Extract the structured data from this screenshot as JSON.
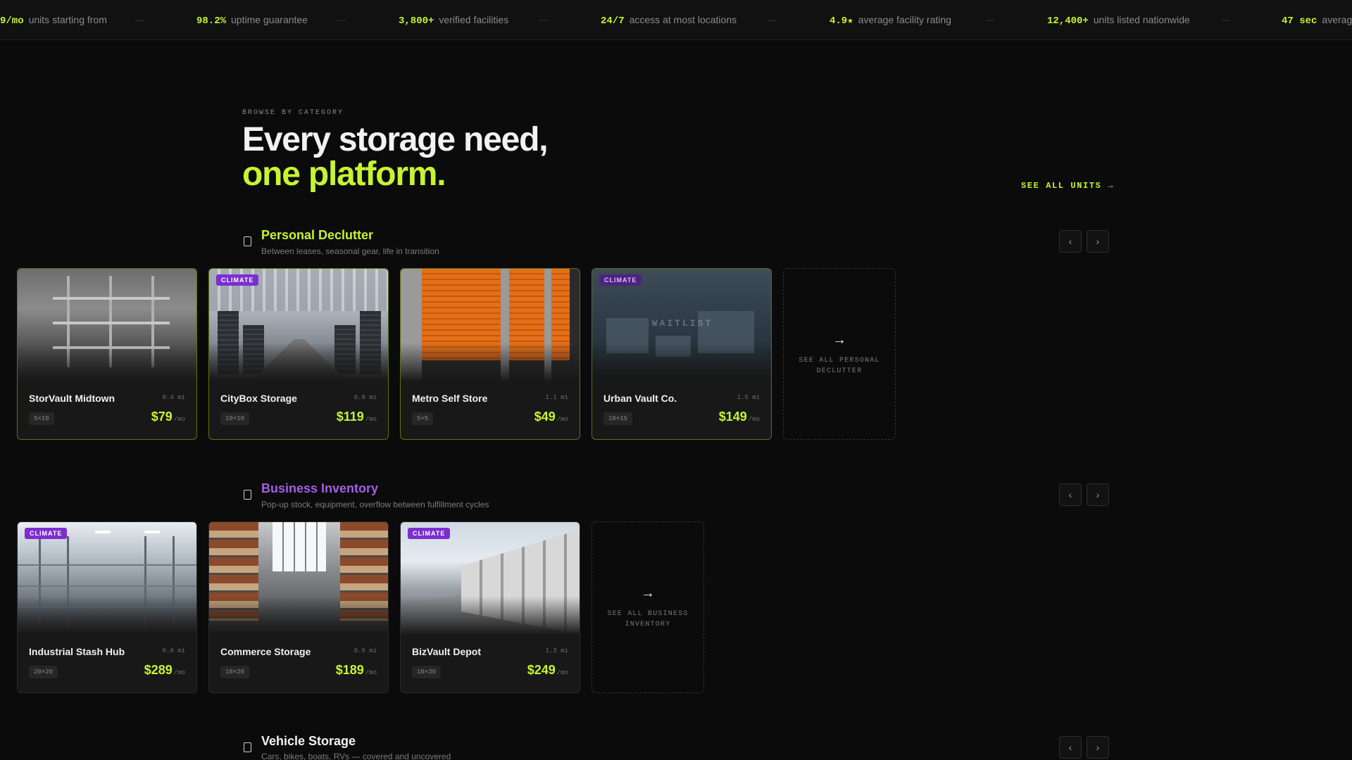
{
  "ticker": [
    {
      "value": "9/mo",
      "label": "units starting from"
    },
    {
      "value": "98.2%",
      "label": "uptime guarantee"
    },
    {
      "value": "3,800+",
      "label": "verified facilities"
    },
    {
      "value": "24/7",
      "label": "access at most locations"
    },
    {
      "value": "4.9★",
      "label": "average facility rating"
    },
    {
      "value": "12,400+",
      "label": "units listed nationwide"
    },
    {
      "value": "47 sec",
      "label": "averag"
    }
  ],
  "ticker_separator": "—",
  "header": {
    "eyebrow": "BROWSE BY CATEGORY",
    "title_line1": "Every storage need,",
    "title_line2": "one platform.",
    "see_all": "SEE ALL UNITS →"
  },
  "nav": {
    "prev": "‹",
    "next": "›"
  },
  "sections": [
    {
      "title": "Personal Declutter",
      "subtitle": "Between leases, seasonal gear, life in transition",
      "color": "#c6f432",
      "see_all": "SEE ALL PERSONAL DECLUTTER",
      "cards": [
        {
          "name": "StorVault Midtown",
          "distance": "0.4 mi",
          "size": "5×10",
          "price": "$79",
          "unit": "/mo",
          "badge": ""
        },
        {
          "name": "CityBox Storage",
          "distance": "0.8 mi",
          "size": "10×10",
          "price": "$119",
          "unit": "/mo",
          "badge": "CLIMATE"
        },
        {
          "name": "Metro Self Store",
          "distance": "1.1 mi",
          "size": "5×5",
          "price": "$49",
          "unit": "/mo",
          "badge": ""
        },
        {
          "name": "Urban Vault Co.",
          "distance": "1.5 mi",
          "size": "10×15",
          "price": "$149",
          "unit": "/mo",
          "badge": "CLIMATE",
          "overlay": "WAITLIST"
        }
      ]
    },
    {
      "title": "Business Inventory",
      "subtitle": "Pop-up stock, equipment, overflow between fulfillment cycles",
      "color": "#a35ee8",
      "see_all": "SEE ALL BUSINESS INVENTORY",
      "cards": [
        {
          "name": "Industrial Stash Hub",
          "distance": "0.6 mi",
          "size": "20×20",
          "price": "$289",
          "unit": "/mo",
          "badge": "CLIMATE"
        },
        {
          "name": "Commerce Storage",
          "distance": "0.9 mi",
          "size": "10×20",
          "price": "$189",
          "unit": "/mo",
          "badge": ""
        },
        {
          "name": "BizVault Depot",
          "distance": "1.3 mi",
          "size": "10×30",
          "price": "$249",
          "unit": "/mo",
          "badge": "CLIMATE"
        }
      ]
    },
    {
      "title": "Vehicle Storage",
      "subtitle": "Cars, bikes, boats, RVs — covered and uncovered",
      "color": "#f2f2f2"
    }
  ],
  "colors": {
    "accent": "#c6f432",
    "purple": "#7b2fd0",
    "background": "#0b0b0b"
  },
  "icons": {
    "section": "box-icon",
    "arrow": "arrow-right-icon"
  }
}
